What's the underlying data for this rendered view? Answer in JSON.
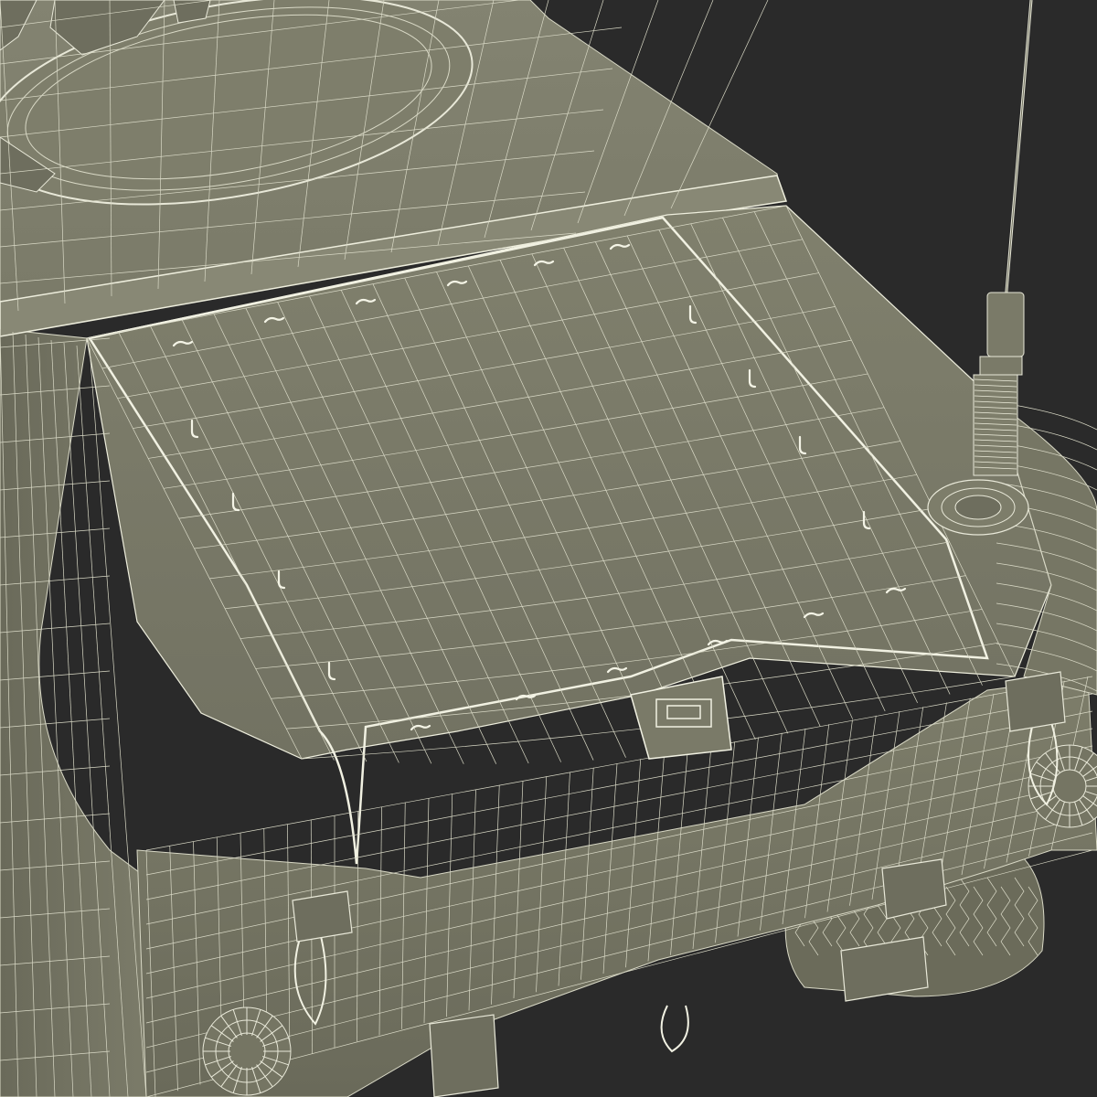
{
  "scene": {
    "subject": "wireframe-render-armored-vehicle-rear",
    "colors": {
      "background": "#2a2a2a",
      "surface": "#7a7a68",
      "surface_dark": "#6c6c5c",
      "surface_light": "#858572",
      "wire": "#d9d9c6",
      "wire_bright": "#f1f1e2",
      "shadow": "#3a3a32"
    }
  }
}
